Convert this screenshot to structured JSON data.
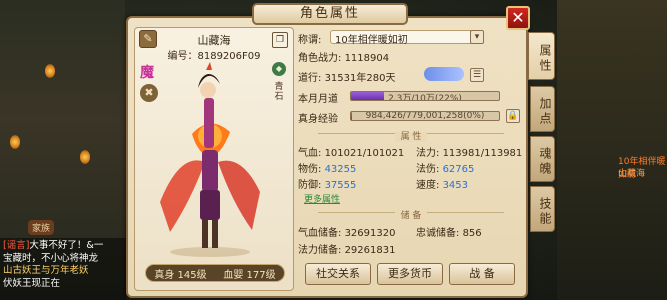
{
  "window": {
    "title": "角色属性",
    "close_icon": "close-icon"
  },
  "character": {
    "name": "山藏海",
    "id_label": "编号：",
    "id_value": "8189206F09",
    "sect_mark": "魔",
    "seal_text": "青石",
    "real_level_label": "真身",
    "real_level": "145级",
    "baby_level_label": "血婴",
    "baby_level": "177级"
  },
  "info": {
    "title_label": "称谓:",
    "title_value": "10年相伴暖如初",
    "power_label": "角色战力:",
    "power_value": "1118904",
    "dao_label": "道行:",
    "dao_value": "31531年280天",
    "dao_badge": "",
    "month_dao_label": "本月月道",
    "month_dao_text": "2.3万/10万(22%)",
    "month_dao_progress": 0.22,
    "exp_label": "真身经验",
    "exp_text": "984,426/779,001,258(0%)",
    "exp_progress": 0.002
  },
  "attributes": {
    "section_title": "属 性",
    "hp_label": "气血:",
    "hp_value": "101021/101021",
    "mp_label": "法力:",
    "mp_value": "113981/113981",
    "phy_atk_label": "物伤:",
    "phy_atk_value": "43255",
    "mag_atk_label": "法伤:",
    "mag_atk_value": "62765",
    "def_label": "防御:",
    "def_value": "37555",
    "speed_label": "速度:",
    "speed_value": "3453",
    "more_label": "更多属性"
  },
  "storage": {
    "section_title": "储 备",
    "hp_store_label": "气血储备:",
    "hp_store_value": "32691320",
    "loyal_store_label": "忠诚储备:",
    "loyal_store_value": "856",
    "mp_store_label": "法力储备:",
    "mp_store_value": "29261831"
  },
  "buttons": {
    "social": "社交关系",
    "currency": "更多货币",
    "battle": "战 备"
  },
  "tabs": [
    "属性",
    "加点",
    "魂魄",
    "技能"
  ],
  "background": {
    "world_tag": "家族",
    "npc_name": "山藏海",
    "npc_title": "10年相伴暖如初",
    "chat_lines": [
      {
        "tag": "[谣言]",
        "text": "大事不好了！&一"
      },
      {
        "tag": "",
        "text": "宝藏时，不小心将神龙"
      },
      {
        "tag": "",
        "text": "山古妖王与万年老妖"
      },
      {
        "tag": "",
        "text": "伏妖王现正在"
      }
    ]
  },
  "colors": {
    "accent": "#8a6a42",
    "close": "#c0241a",
    "blue_stat": "#2d6fd6",
    "purple_bar": "#7a3fc0"
  }
}
